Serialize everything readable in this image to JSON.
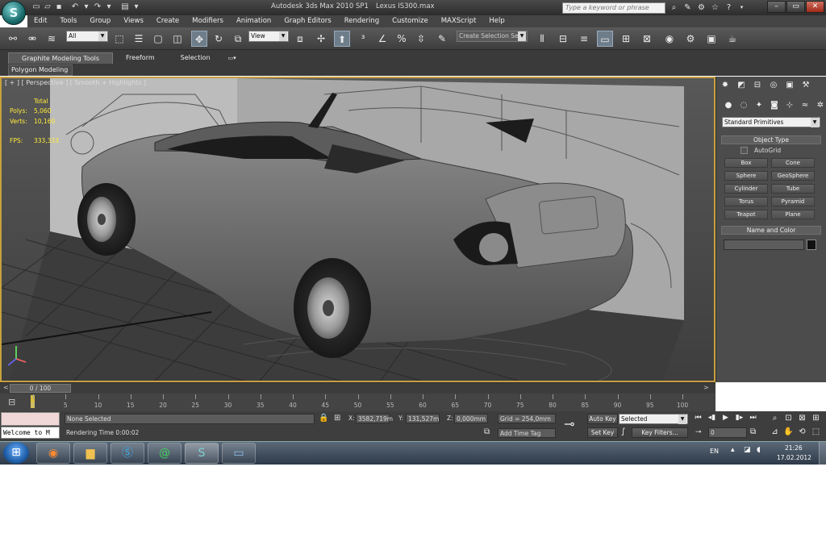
{
  "window": {
    "title": "Autodesk 3ds Max  2010 SP1",
    "file": "Lexus IS300.max",
    "search_placeholder": "Type a keyword or phrase",
    "controls": [
      "–",
      "▭",
      "✕"
    ]
  },
  "menu": [
    "Edit",
    "Tools",
    "Group",
    "Views",
    "Create",
    "Modifiers",
    "Animation",
    "Graph Editors",
    "Rendering",
    "Customize",
    "MAXScript",
    "Help"
  ],
  "toolbar": {
    "selection_filter": "All",
    "ref_coord_system": "View",
    "named_selection_set": "Create Selection Se"
  },
  "ribbon": {
    "tabs": [
      "Graphite Modeling Tools",
      "Freeform",
      "Selection"
    ],
    "panel": "Polygon Modeling"
  },
  "viewport": {
    "label": "[ + ] [ Perspective ] [ Smooth + Highlights ]",
    "stats": {
      "total_label": "Total",
      "polys_label": "Polys:",
      "polys": "5,060",
      "verts_label": "Verts:",
      "verts": "10,160",
      "fps_label": "FPS:",
      "fps": "333,333"
    }
  },
  "command_panel": {
    "category": "Standard Primitives",
    "object_type_title": "Object Type",
    "autogrid": "AutoGrid",
    "primitives": [
      "Box",
      "Cone",
      "Sphere",
      "GeoSphere",
      "Cylinder",
      "Tube",
      "Torus",
      "Pyramid",
      "Teapot",
      "Plane"
    ],
    "name_color_title": "Name and Color"
  },
  "timeline": {
    "frame_display": "0 / 100",
    "ticks": [
      "0",
      "5",
      "10",
      "15",
      "20",
      "25",
      "30",
      "35",
      "40",
      "45",
      "50",
      "55",
      "60",
      "65",
      "70",
      "75",
      "80",
      "85",
      "90",
      "95",
      "100"
    ]
  },
  "status": {
    "script_listener": "Welcome to M",
    "selection": "None Selected",
    "rendering_time": "Rendering Time  0:00:02",
    "x_label": "X:",
    "x_value": "3582,719m",
    "y_label": "Y:",
    "y_value": "131,527m",
    "z_label": "Z:",
    "z_value": "0,000mm",
    "grid": "Grid = 254,0mm",
    "add_time_tag": "Add Time Tag",
    "auto_key": "Auto Key",
    "key_mode": "Selected",
    "set_key": "Set Key",
    "key_filters": "Key Filters...",
    "current_frame": "0"
  },
  "taskbar": {
    "language": "EN",
    "time": "21:26",
    "date": "17.02.2012"
  }
}
